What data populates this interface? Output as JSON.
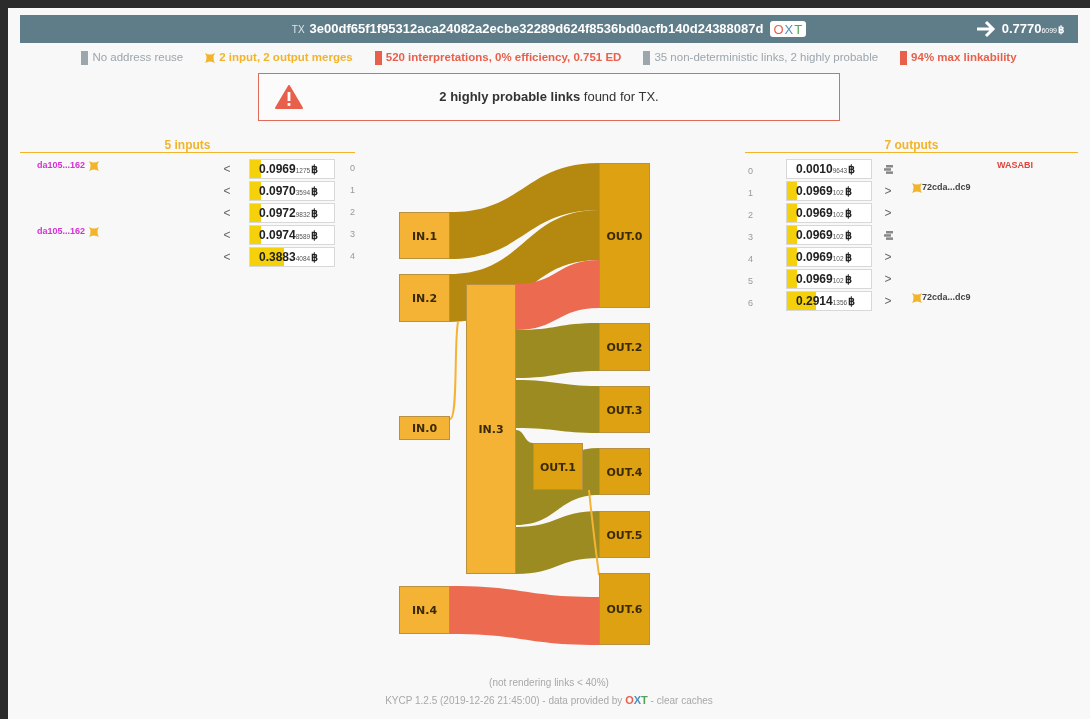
{
  "header": {
    "tx_label": "TX",
    "txid": "3e00df65f1f95312aca24082a2ecbe32289d624f8536bd0acfb140d24388087d",
    "badge_letters": [
      {
        "text": "O",
        "color": "#e8604c"
      },
      {
        "text": "X",
        "color": "#4f8fc0"
      },
      {
        "text": "T",
        "color": "#55a35a"
      }
    ],
    "amount": {
      "main": "0.7770",
      "sub": "6099",
      "unit": "฿"
    }
  },
  "stats": [
    {
      "kind": "marker",
      "text": "No address reuse",
      "color": "#9ba6ad"
    },
    {
      "kind": "merge",
      "text": "2 input, 2 output merges",
      "color": "#f2b42b"
    },
    {
      "kind": "marker",
      "text": "520 interpretations, 0% efficiency, 0.751 ED",
      "color": "#e8604c"
    },
    {
      "kind": "marker",
      "text": "35 non-deterministic links, 2 highly probable",
      "color": "#9ba6ad"
    },
    {
      "kind": "marker",
      "text": "94% max linkability",
      "color": "#e8604c"
    }
  ],
  "alert": {
    "text": "**2 highly probable links** found for TX."
  },
  "inputs": {
    "title": "5 inputs",
    "rows": [
      {
        "address": "da105...162",
        "merge": true,
        "chevron": "<",
        "main": "0.0969",
        "sub": "1275",
        "unit": "฿",
        "index": "0",
        "level": 0.13
      },
      {
        "chevron": "<",
        "main": "0.0970",
        "sub": "3594",
        "unit": "฿",
        "index": "1",
        "level": 0.13
      },
      {
        "chevron": "<",
        "main": "0.0972",
        "sub": "9832",
        "unit": "฿",
        "index": "2",
        "level": 0.13
      },
      {
        "address": "da105...162",
        "merge": true,
        "chevron": "<",
        "main": "0.0974",
        "sub": "8589",
        "unit": "฿",
        "index": "3",
        "level": 0.13
      },
      {
        "chevron": "<",
        "main": "0.3883",
        "sub": "4084",
        "unit": "฿",
        "index": "4",
        "level": 0.41
      }
    ]
  },
  "outputs": {
    "title": "7 outputs",
    "rows": [
      {
        "index": "0",
        "main": "0.0010",
        "sub": "9643",
        "unit": "฿",
        "level": 0.0,
        "kind": "stack",
        "tag": {
          "kind": "wallet",
          "text": "WASABI"
        }
      },
      {
        "index": "1",
        "main": "0.0969",
        "sub": "102",
        "unit": "฿",
        "level": 0.12,
        "kind": "chevron",
        "chevron": ">",
        "tag": {
          "kind": "address",
          "text": "72cda...dc9"
        }
      },
      {
        "index": "2",
        "main": "0.0969",
        "sub": "102",
        "unit": "฿",
        "level": 0.12,
        "kind": "chevron",
        "chevron": ">"
      },
      {
        "index": "3",
        "main": "0.0969",
        "sub": "102",
        "unit": "฿",
        "level": 0.12,
        "kind": "stack"
      },
      {
        "index": "4",
        "main": "0.0969",
        "sub": "102",
        "unit": "฿",
        "level": 0.12,
        "kind": "chevron",
        "chevron": ">"
      },
      {
        "index": "5",
        "main": "0.0969",
        "sub": "102",
        "unit": "฿",
        "level": 0.12,
        "kind": "chevron",
        "chevron": ">"
      },
      {
        "index": "6",
        "main": "0.2914",
        "sub": "1356",
        "unit": "฿",
        "level": 0.35,
        "kind": "chevron",
        "chevron": ">",
        "tag": {
          "kind": "address",
          "text": "72cda...dc9"
        }
      }
    ]
  },
  "sankey": {
    "nodes": [
      {
        "kind": "input",
        "label": "IN.1"
      },
      {
        "kind": "input",
        "label": "IN.2"
      },
      {
        "kind": "input",
        "label": "IN.0"
      },
      {
        "kind": "input",
        "label": "IN.3"
      },
      {
        "kind": "input",
        "label": "IN.4"
      },
      {
        "kind": "output",
        "label": "OUT.0"
      },
      {
        "kind": "output",
        "label": "OUT.2"
      },
      {
        "kind": "output",
        "label": "OUT.3"
      },
      {
        "kind": "output",
        "label": "OUT.1"
      },
      {
        "kind": "output",
        "label": "OUT.4"
      },
      {
        "kind": "output",
        "label": "OUT.5"
      },
      {
        "kind": "output",
        "label": "OUT.6"
      }
    ],
    "links": [
      {
        "color": "#b5880f"
      },
      {
        "color": "#b5880f"
      },
      {
        "color": "#ec6b50"
      },
      {
        "color": "#9c8b20"
      },
      {
        "color": "#9c8b20"
      },
      {
        "color": "#9c8b20"
      },
      {
        "color": "#9c8b20"
      },
      {
        "color": "#9c8b20"
      },
      {
        "color": "#ec6b50"
      },
      {
        "color": "#f5b335"
      },
      {
        "color": "#f5b335"
      }
    ]
  },
  "footer": {
    "note": "(not rendering links < 40%)",
    "credit_prefix": "KYCP 1.2.5 (2019-12-26 21:45:00) - data provided by",
    "oxt_letters": [
      {
        "text": "O",
        "color": "#e8604c"
      },
      {
        "text": "X",
        "color": "#4f8fc0"
      },
      {
        "text": "T",
        "color": "#55a35a"
      }
    ],
    "separator": "-",
    "clear_link": "clear caches"
  }
}
